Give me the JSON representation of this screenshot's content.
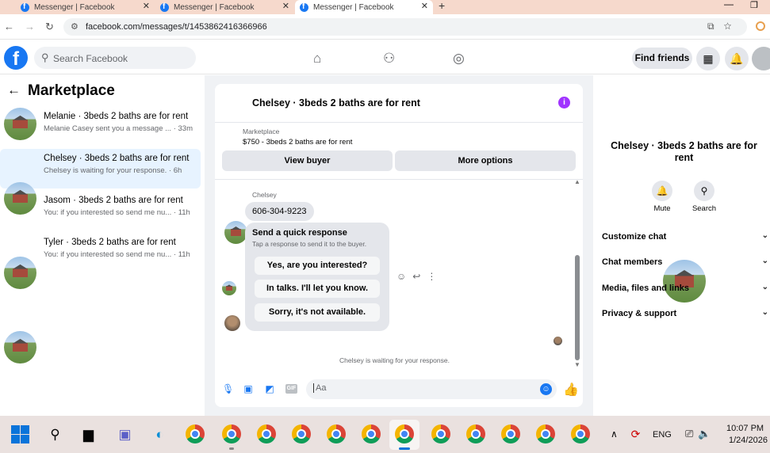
{
  "browser": {
    "tabs": [
      {
        "title": "Messenger | Facebook",
        "active": false
      },
      {
        "title": "Messenger | Facebook",
        "active": false
      },
      {
        "title": "Messenger | Facebook",
        "active": true
      }
    ],
    "new_tab": "+",
    "minimize": "—",
    "maximize": "❐",
    "url": "facebook.com/messages/t/1453862416366966"
  },
  "fb": {
    "logo": "f",
    "search_placeholder": "Search Facebook",
    "find_friends": "Find friends"
  },
  "left": {
    "title": "Marketplace",
    "conversations": [
      {
        "name": "Melanie · 3beds 2 baths are for rent",
        "preview": "Melanie Casey sent you a message ...",
        "time": "· 33m",
        "selected": false
      },
      {
        "name": "Chelsey · 3beds 2 baths are for rent",
        "preview": "Chelsey is waiting for your response.",
        "time": "· 6h",
        "selected": true
      },
      {
        "name": "Jasom · 3beds 2 baths are for rent",
        "preview": "You: if you interested so send me nu...",
        "time": "· 11h",
        "selected": false
      },
      {
        "name": "Tyler · 3beds 2 baths are for rent",
        "preview": "You: if you interested so send me nu...",
        "time": "· 11h",
        "selected": false
      }
    ]
  },
  "chat": {
    "title": "Chelsey · 3beds 2 baths are for rent",
    "info": "i",
    "marketplace_label": "Marketplace",
    "listing": "$750 - 3beds 2 baths are for rent",
    "view_buyer": "View buyer",
    "more_options": "More options",
    "sender": "Chelsey",
    "phone_message": "606-304-9223",
    "quick_response_title": "Send a quick response",
    "quick_response_sub": "Tap a response to send it to the buyer.",
    "quick_responses": [
      "Yes, are you interested?",
      "In talks. I'll let you know.",
      "Sorry, it's not available."
    ],
    "waiting": "Chelsey is waiting for your response.",
    "composer_placeholder": "Aa",
    "gif": "GIF"
  },
  "right": {
    "title": "Chelsey · 3beds 2 baths are for rent",
    "mute": "Mute",
    "search": "Search",
    "sections": [
      "Customize chat",
      "Chat members",
      "Media, files and links",
      "Privacy & support"
    ]
  },
  "taskbar": {
    "lang": "ENG",
    "time": "10:07 PM",
    "date": "1/24/2026"
  },
  "colors": {
    "fb_blue": "#1877f2",
    "selected_row": "#e7f3ff",
    "info_purple": "#a033ff"
  }
}
